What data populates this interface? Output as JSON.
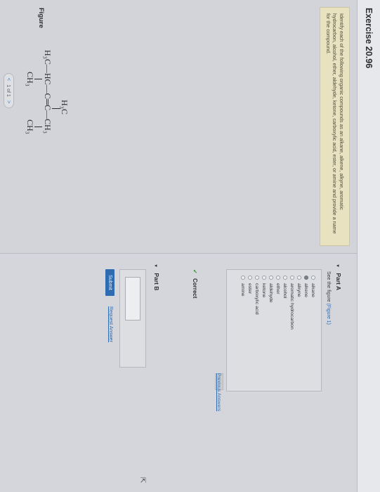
{
  "exercise": {
    "title": "Exercise 20.96"
  },
  "instructions": "Identify each of the following organic compounds as an alkane, alkene, alkyne, aromatic hydrocarbon, alcohol, ether, aldehyde, ketone, carboxylic acid, ester, or amine and provide a name for the compound.",
  "figure": {
    "label": "Figure",
    "molecule": {
      "top_substituent": "H₃C",
      "main_chain": "H₃C—HC—C═C—CH₃",
      "bottom_left": "CH₃",
      "bottom_right": "CH₃"
    },
    "pager": {
      "prev": "<",
      "text": "1 of 1",
      "next": ">"
    }
  },
  "partA": {
    "title": "Part A",
    "see_figure_prefix": "See the figure",
    "see_figure_link": "(Figure 1)",
    "options": [
      "alkane",
      "alkene",
      "alkyne",
      "aromatic hydrocarbon",
      "alcohol",
      "ether",
      "aldehyde",
      "ketone",
      "carboxylic acid",
      "ester",
      "amine"
    ],
    "selected": "alkene",
    "previous_answers": "Previous Answers",
    "result": "Correct"
  },
  "partB": {
    "title": "Part B",
    "submit": "Submit",
    "request_answer": "Request Answer"
  },
  "icons": {
    "check": "check-icon",
    "triangle": "caret-down-icon",
    "cursor": "mouse-pointer-icon"
  },
  "colors": {
    "link": "#2f6bb0",
    "correct": "#3a9a3a",
    "instructions_bg": "#e8e2c1"
  }
}
